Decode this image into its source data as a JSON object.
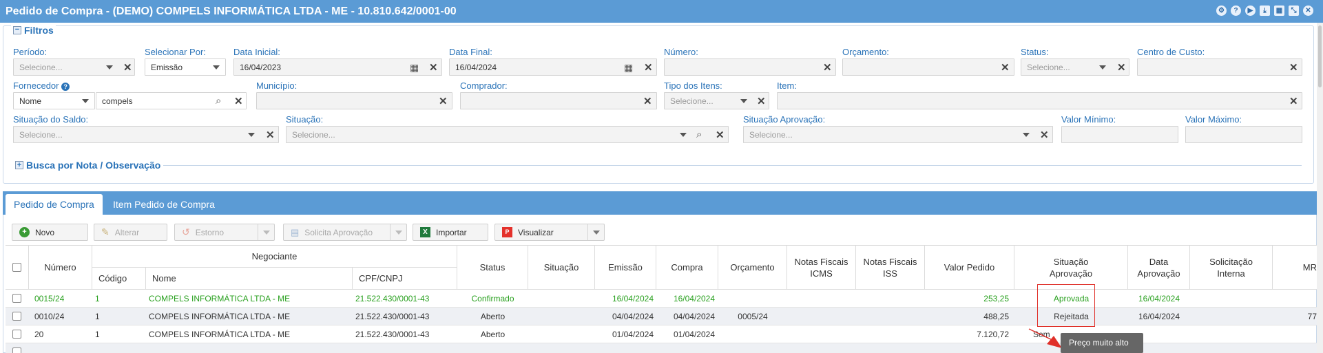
{
  "window": {
    "title": "Pedido de Compra - (DEMO) COMPELS INFORMÁTICA LTDA - ME - 10.810.642/0001-00",
    "title_icons": [
      "gear-icon",
      "help-icon",
      "play-icon",
      "download-icon",
      "calendar-icon",
      "collapse-icon",
      "close-icon"
    ]
  },
  "filters": {
    "legend": "Filtros",
    "periodo": {
      "label": "Período:",
      "placeholder": "Selecione..."
    },
    "selecionar_por": {
      "label": "Selecionar Por:",
      "value": "Emissão"
    },
    "data_inicial": {
      "label": "Data Inicial:",
      "value": "16/04/2023"
    },
    "data_final": {
      "label": "Data Final:",
      "value": "16/04/2024"
    },
    "numero": {
      "label": "Número:",
      "value": ""
    },
    "orcamento": {
      "label": "Orçamento:",
      "value": ""
    },
    "status": {
      "label": "Status:",
      "placeholder": "Selecione..."
    },
    "centro_custo": {
      "label": "Centro de Custo:",
      "value": ""
    },
    "fornecedor": {
      "label": "Fornecedor",
      "help": "?",
      "type_value": "Nome",
      "value": "compels"
    },
    "municipio": {
      "label": "Município:",
      "value": ""
    },
    "comprador": {
      "label": "Comprador:",
      "value": ""
    },
    "tipo_itens": {
      "label": "Tipo dos Itens:",
      "placeholder": "Selecione..."
    },
    "item": {
      "label": "Item:",
      "value": ""
    },
    "situacao_saldo": {
      "label": "Situação do Saldo:",
      "placeholder": "Selecione..."
    },
    "situacao": {
      "label": "Situação:",
      "placeholder": "Selecione..."
    },
    "situacao_aprovacao": {
      "label": "Situação Aprovação:",
      "placeholder": "Selecione..."
    },
    "valor_minimo": {
      "label": "Valor Mínimo:",
      "value": ""
    },
    "valor_maximo": {
      "label": "Valor Máximo:",
      "value": ""
    },
    "busca_nota": "Busca por Nota / Observação"
  },
  "tabs": [
    {
      "label": "Pedido de Compra",
      "active": true
    },
    {
      "label": "Item Pedido de Compra",
      "active": false
    }
  ],
  "toolbar": {
    "novo": "Novo",
    "alterar": "Alterar",
    "estorno": "Estorno",
    "solicita_aprovacao": "Solicita Aprovação",
    "importar": "Importar",
    "visualizar": "Visualizar"
  },
  "grid": {
    "headers": {
      "numero": "Número",
      "negociante": "Negociante",
      "codigo": "Código",
      "nome": "Nome",
      "cpf": "CPF/CNPJ",
      "status": "Status",
      "situacao": "Situação",
      "emissao": "Emissão",
      "compra": "Compra",
      "orcamento": "Orçamento",
      "nf_icms_1": "Notas Fiscais",
      "nf_icms_2": "ICMS",
      "nf_iss_1": "Notas Fiscais",
      "nf_iss_2": "ISS",
      "valor_pedido": "Valor Pedido",
      "sit_aprov_1": "Situação",
      "sit_aprov_2": "Aprovação",
      "data_aprov_1": "Data",
      "data_aprov_2": "Aprovação",
      "sol_interna_1": "Solicitação",
      "sol_interna_2": "Interna",
      "mr": "MR"
    },
    "rows": [
      {
        "numero": "0015/24",
        "codigo": "1",
        "nome": "COMPELS INFORMÁTICA LTDA - ME",
        "cpf": "21.522.430/0001-43",
        "status": "Confirmado",
        "situacao": "",
        "emissao": "16/04/2024",
        "compra": "16/04/2024",
        "orcamento": "",
        "valor": "253,25",
        "sit_aprov": "Aprovada",
        "data_aprov": "16/04/2024",
        "mr": "",
        "highlight": true
      },
      {
        "numero": "0010/24",
        "codigo": "1",
        "nome": "COMPELS INFORMÁTICA LTDA - ME",
        "cpf": "21.522.430/0001-43",
        "status": "Aberto",
        "situacao": "",
        "emissao": "04/04/2024",
        "compra": "04/04/2024",
        "orcamento": "0005/24",
        "valor": "488,25",
        "sit_aprov": "Rejeitada",
        "data_aprov": "16/04/2024",
        "mr": "77",
        "highlight": false
      },
      {
        "numero": "20",
        "codigo": "1",
        "nome": "COMPELS INFORMÁTICA LTDA - ME",
        "cpf": "21.522.430/0001-43",
        "status": "Aberto",
        "situacao": "",
        "emissao": "01/04/2024",
        "compra": "01/04/2024",
        "orcamento": "",
        "valor": "7.120,72",
        "sit_aprov": "Sem",
        "data_aprov": "",
        "mr": "",
        "highlight": false
      }
    ]
  },
  "tooltip": "Preço muito alto"
}
